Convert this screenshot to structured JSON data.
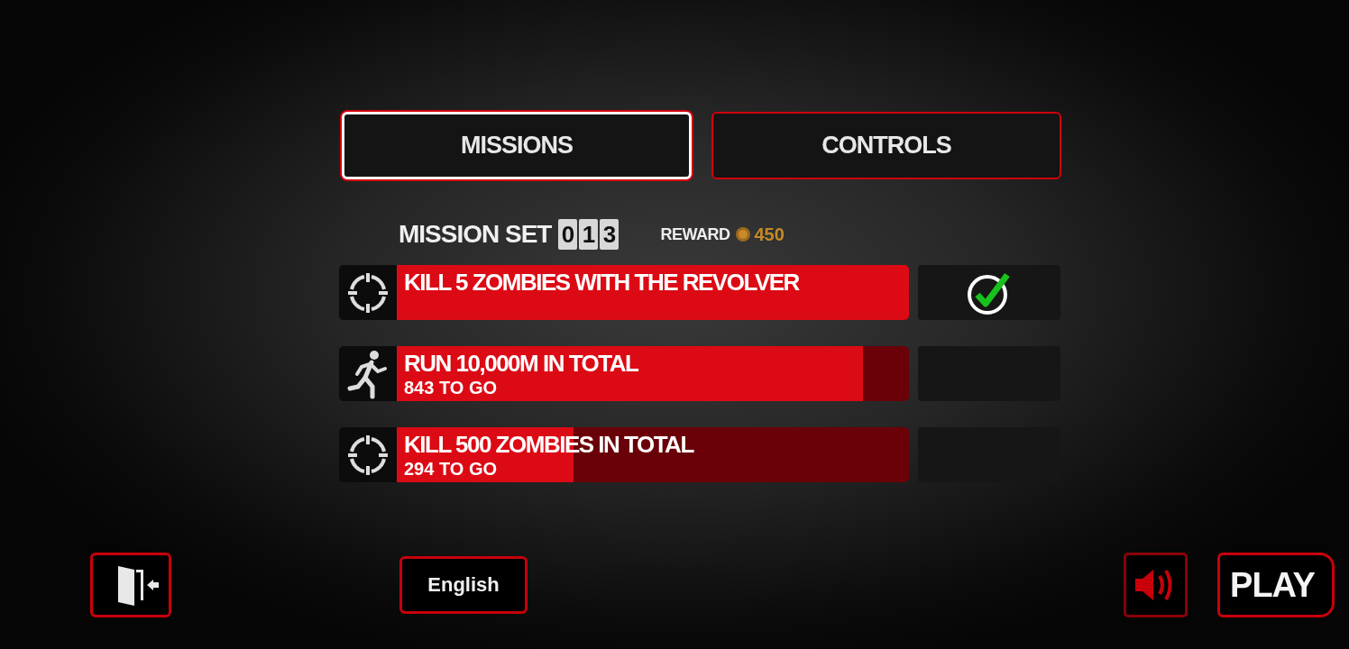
{
  "tabs": [
    {
      "label": "MISSIONS",
      "selected": true
    },
    {
      "label": "CONTROLS",
      "selected": false
    }
  ],
  "mission_set": {
    "label": "MISSION SET",
    "digits": [
      "0",
      "1",
      "3"
    ],
    "reward_label": "REWARD",
    "reward": "450"
  },
  "missions": [
    {
      "kind": "target",
      "title": "KILL 5 ZOMBIES WITH THE REVOLVER",
      "level": 1,
      "completed": true
    },
    {
      "kind": "runner",
      "title": "RUN 10,000M IN TOTAL",
      "remaining": "843 TO GO",
      "level": 0.91,
      "completed": false
    },
    {
      "kind": "target",
      "title": "KILL 500 ZOMBIES IN TOTAL",
      "remaining": "294 TO GO",
      "level": 0.345,
      "completed": false
    }
  ],
  "language": "English",
  "sound": {
    "on": true
  },
  "play": "PLAY"
}
